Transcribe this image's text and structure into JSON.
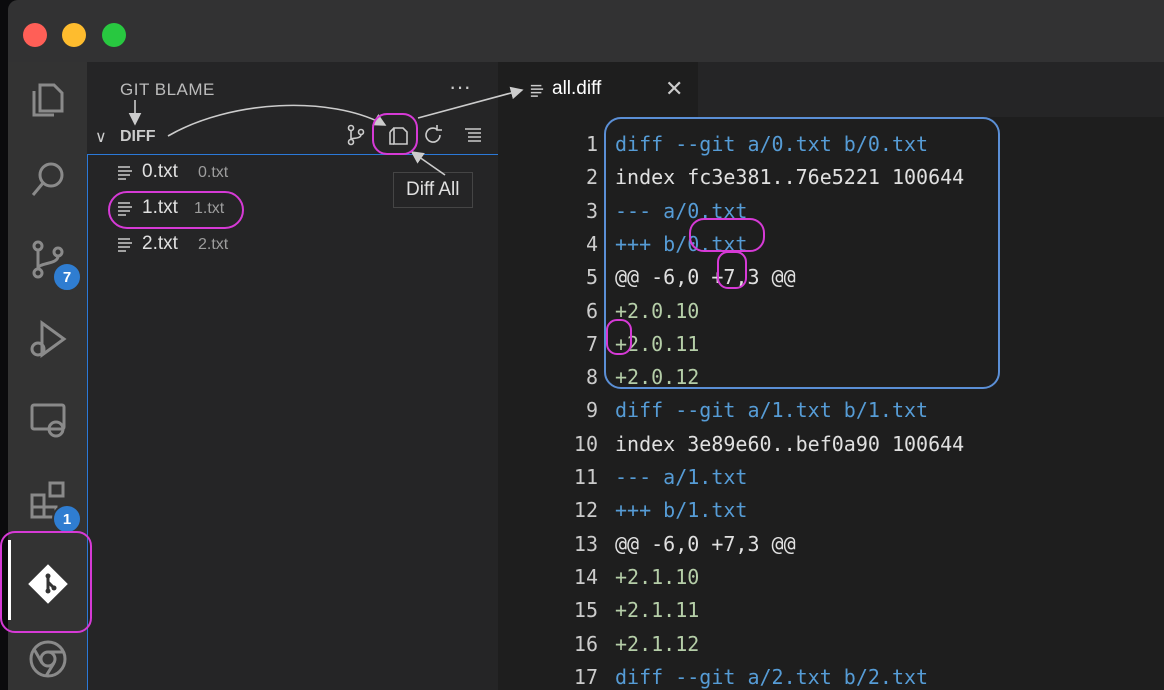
{
  "colors": {
    "titlebar": "#323233",
    "activitybar": "#333333",
    "sidebar": "#252526",
    "editor": "#1e1e1e",
    "accent_blue": "#2f7dd1",
    "annotation_magenta": "#d63ad6",
    "annotation_blue": "#5b8fd6"
  },
  "activity_bar": {
    "items": [
      {
        "name": "explorer-icon"
      },
      {
        "name": "search-icon"
      },
      {
        "name": "source-control-icon",
        "badge": "7"
      },
      {
        "name": "run-debug-icon"
      },
      {
        "name": "remote-explorer-icon"
      },
      {
        "name": "extensions-icon",
        "badge": "1"
      },
      {
        "name": "git-extension-icon"
      },
      {
        "name": "chrome-icon"
      }
    ]
  },
  "sidebar": {
    "title": "GIT BLAME",
    "more_actions": "···",
    "section": {
      "chevron": "∨",
      "name": "DIFF",
      "actions": [
        "branch-icon",
        "diff-all-icon",
        "refresh-icon",
        "collapse-icon"
      ]
    },
    "files": [
      {
        "name": "0.txt",
        "description": "0.txt"
      },
      {
        "name": "1.txt",
        "description": "1.txt"
      },
      {
        "name": "2.txt",
        "description": "2.txt"
      }
    ],
    "tooltip": "Diff All"
  },
  "editor": {
    "tab": {
      "label": "all.diff",
      "close": "✕"
    },
    "lines": [
      {
        "n": "1",
        "text": "diff --git a/0.txt b/0.txt",
        "kind": "meta"
      },
      {
        "n": "2",
        "text": "index fc3e381..76e5221 100644",
        "kind": "plain"
      },
      {
        "n": "3",
        "text": "--- a/0.txt",
        "kind": "meta"
      },
      {
        "n": "4",
        "text": "+++ b/0.txt",
        "kind": "meta"
      },
      {
        "n": "5",
        "text": "@@ -6,0 +7,3 @@",
        "kind": "plain"
      },
      {
        "n": "6",
        "text": "+2.0.10",
        "kind": "add"
      },
      {
        "n": "7",
        "text": "+2.0.11",
        "kind": "add"
      },
      {
        "n": "8",
        "text": "+2.0.12",
        "kind": "add"
      },
      {
        "n": "9",
        "text": "diff --git a/1.txt b/1.txt",
        "kind": "meta"
      },
      {
        "n": "10",
        "text": "index 3e89e60..bef0a90 100644",
        "kind": "plain"
      },
      {
        "n": "11",
        "text": "--- a/1.txt",
        "kind": "meta"
      },
      {
        "n": "12",
        "text": "+++ b/1.txt",
        "kind": "meta"
      },
      {
        "n": "13",
        "text": "@@ -6,0 +7,3 @@",
        "kind": "plain"
      },
      {
        "n": "14",
        "text": "+2.1.10",
        "kind": "add"
      },
      {
        "n": "15",
        "text": "+2.1.11",
        "kind": "add"
      },
      {
        "n": "16",
        "text": "+2.1.12",
        "kind": "add"
      },
      {
        "n": "17",
        "text": "diff --git a/2.txt b/2.txt",
        "kind": "meta"
      }
    ]
  }
}
